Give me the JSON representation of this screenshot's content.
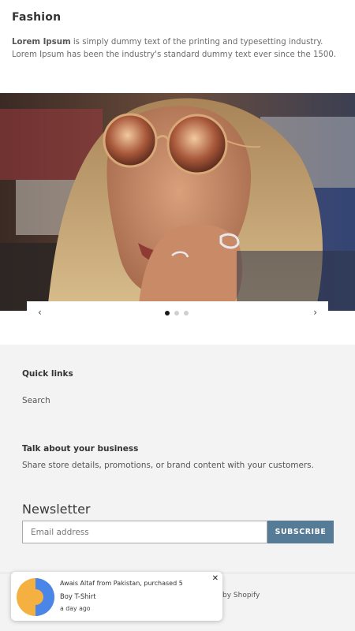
{
  "section": {
    "title": "Fashion",
    "bold_text": "Lorem Ipsum",
    "body_text": " is simply dummy text of the printing and typesetting industry. Lorem Ipsum has been the industry's standard dummy text ever since the 1500."
  },
  "slideshow": {
    "prev_icon": "‹",
    "next_icon": "›",
    "slide_count": 3,
    "active_slide": 1
  },
  "footer": {
    "quick_links_heading": "Quick links",
    "search_link": "Search",
    "about_heading": "Talk about your business",
    "about_text": "Share store details, promotions, or brand content with your customers.",
    "newsletter_heading": "Newsletter",
    "email_placeholder": "Email address",
    "subscribe_label": "SUBSCRIBE",
    "powered_by": "by Shopify"
  },
  "notification": {
    "line1": "Awais Altaf from Pakistan, purchased 5",
    "product": "Boy T-Shirt",
    "time": "a day ago",
    "close_icon": "✕"
  },
  "colors": {
    "accent": "#557b97",
    "footer_bg": "#f3f3f3"
  }
}
